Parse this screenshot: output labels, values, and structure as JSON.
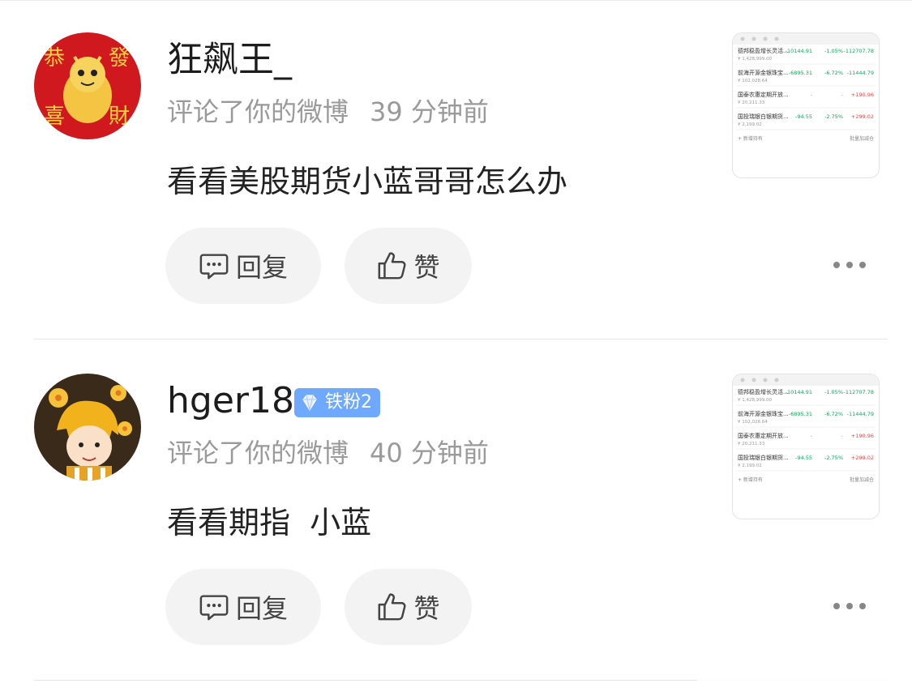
{
  "comments": [
    {
      "username": "狂飙王_",
      "action": "评论了你的微博",
      "time": "39 分钟前",
      "text": "看看美股期货小蓝哥哥怎么办",
      "reply_label": "回复",
      "like_label": "赞",
      "avatar": {
        "text_tl": "恭",
        "text_tr": "發",
        "text_bl": "喜",
        "text_br": "財"
      }
    },
    {
      "username": "hger18",
      "badge": "铁粉2",
      "action": "评论了你的微博",
      "time": "40 分钟前",
      "text": "看看期指  小蓝",
      "reply_label": "回复",
      "like_label": "赞"
    }
  ],
  "thumbnail": {
    "rows": [
      {
        "name": "德邦稳盈增长灵活...",
        "sub": "¥ 1,428,999.00",
        "v1": "-10144.91",
        "v2": "-1.05%",
        "v3": "-112707.78"
      },
      {
        "name": "前海开源金银珠宝...",
        "sub": "¥ 102,028.64",
        "v1": "-6895.31",
        "v2": "-6.72%",
        "v3": "-11444.79"
      },
      {
        "name": "国泰农惠定期开放...",
        "sub": "¥ 20,211.33",
        "v1": "-",
        "v2": "-",
        "v3": "+190.96"
      },
      {
        "name": "国投瑞银白银期货...",
        "sub": "¥ 2,199.02",
        "v1": "-94.55",
        "v2": "-2.75%",
        "v3": "+299.02"
      }
    ],
    "footer_left": "+ 新增持有",
    "footer_right": "批量加减仓"
  },
  "colors": {
    "green": "#1aa35c",
    "red": "#e24a4a",
    "badge": "#6fa8ff"
  }
}
